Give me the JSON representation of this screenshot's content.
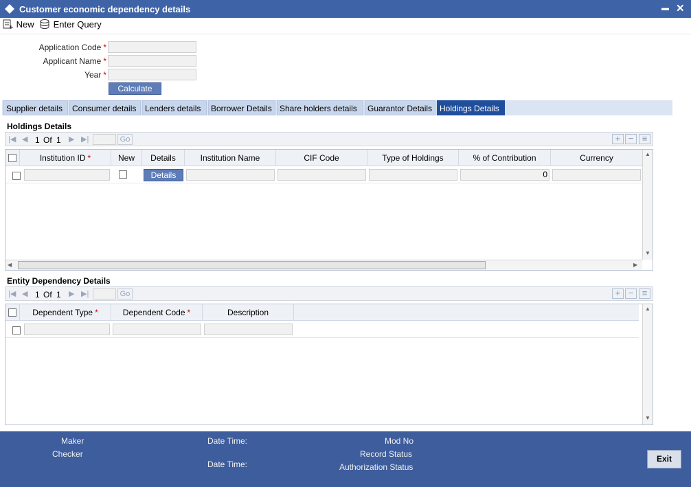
{
  "window": {
    "title": "Customer economic dependency details",
    "minimize_glyph": "▬",
    "close_glyph": "✕"
  },
  "toolbar": {
    "new_label": "New",
    "enter_query_label": "Enter Query"
  },
  "form": {
    "application_code_label": "Application Code",
    "applicant_name_label": "Applicant Name",
    "year_label": "Year",
    "required_marker": "*",
    "calculate_label": "Calculate"
  },
  "tabs": [
    {
      "label": "Supplier details"
    },
    {
      "label": "Consumer details"
    },
    {
      "label": "Lenders details"
    },
    {
      "label": "Borrower Details"
    },
    {
      "label": "Share holders details"
    },
    {
      "label": "Guarantor Details"
    },
    {
      "label": "Holdings Details",
      "active": true
    }
  ],
  "holdings": {
    "title": "Holdings Details",
    "pager": {
      "current": "1",
      "of_label": "Of",
      "total": "1",
      "go_label": "Go"
    },
    "columns": [
      "Institution ID",
      "New",
      "Details",
      "Institution Name",
      "CIF Code",
      "Type of Holdings",
      "% of Contribution",
      "Currency"
    ],
    "row": {
      "details_button": "Details",
      "contribution": "0"
    }
  },
  "entity": {
    "title": "Entity Dependency Details",
    "pager": {
      "current": "1",
      "of_label": "Of",
      "total": "1",
      "go_label": "Go"
    },
    "columns": [
      "Dependent Type",
      "Dependent Code",
      "Description"
    ]
  },
  "footer": {
    "maker": "Maker",
    "checker": "Checker",
    "date_time_1": "Date Time:",
    "date_time_2": "Date Time:",
    "mod_no": "Mod No",
    "record_status": "Record Status",
    "authorization_status": "Authorization Status",
    "exit_label": "Exit"
  },
  "colors": {
    "titlebar": "#3e63a6",
    "active_tab": "#1f4e9b",
    "footer": "#3e5d9d"
  }
}
